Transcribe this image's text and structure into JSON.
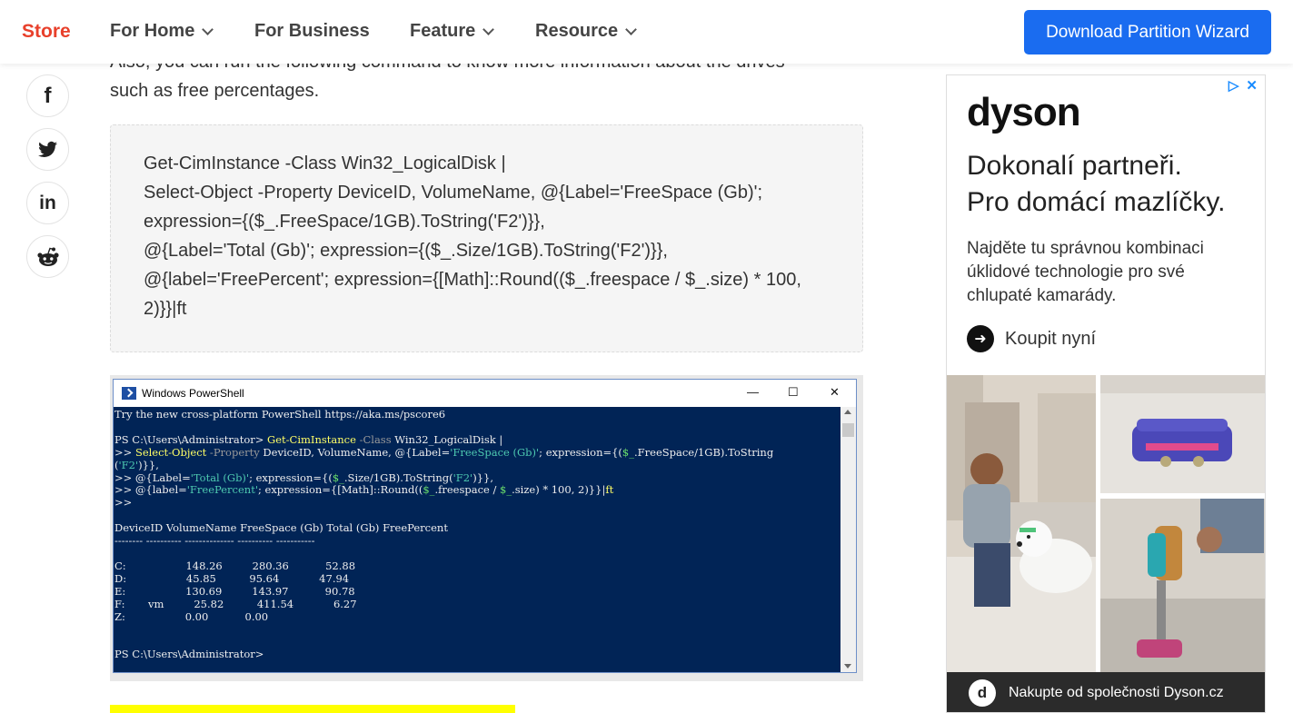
{
  "header": {
    "logo": "Store",
    "nav": [
      {
        "label": "For Home",
        "dropdown": true
      },
      {
        "label": "For Business",
        "dropdown": false
      },
      {
        "label": "Feature",
        "dropdown": true
      },
      {
        "label": "Resource",
        "dropdown": true
      }
    ],
    "download_button": "Download Partition Wizard"
  },
  "share": {
    "icons": [
      "facebook-icon",
      "twitter-icon",
      "linkedin-icon",
      "reddit-icon"
    ],
    "labels": {
      "facebook": "f",
      "linkedin": "in"
    }
  },
  "article": {
    "intro_line1": "Also, you can run the following command to know more information about the drives",
    "intro_line2": "such as free percentages.",
    "code_lines": [
      "Get-CimInstance -Class Win32_LogicalDisk |",
      "Select-Object -Property DeviceID, VolumeName, @{Label='FreeSpace (Gb)';",
      "expression={($_.FreeSpace/1GB).ToString('F2')}},",
      "@{Label='Total (Gb)'; expression={($_.Size/1GB).ToString('F2')}},",
      "@{label='FreePercent'; expression={[Math]::Round(($_.freespace / $_.size) * 100,",
      "2)}}|ft"
    ]
  },
  "powershell": {
    "title": "Windows PowerShell",
    "controls": {
      "minimize": "—",
      "maximize": "☐",
      "close": "✕"
    },
    "intro": "Try the new cross-platform PowerShell https://aka.ms/pscore6",
    "prompt": "PS C:\\Users\\Administrator>",
    "cmd1_a": " Get-CimInstance",
    "cmd1_b": " -Class",
    "cmd1_c": " Win32_LogicalDisk |",
    "cmd2_a": ">> ",
    "cmd2_b": "Select-Object",
    "cmd2_c": " -Property",
    "cmd2_d": " DeviceID, VolumeName, @{Label=",
    "cmd2_e": "'FreeSpace (Gb)'",
    "cmd2_f": "; expression={(",
    "cmd2_g": "$_",
    "cmd2_h": ".FreeSpace/1GB).ToString",
    "cmd3_a": "(",
    "cmd3_b": "'F2'",
    "cmd3_c": ")}},",
    "cmd4_a": ">> @{Label=",
    "cmd4_b": "'Total (Gb)'",
    "cmd4_c": "; expression={(",
    "cmd4_d": "$_",
    "cmd4_e": ".Size/1GB).ToString(",
    "cmd4_f": "'F2'",
    "cmd4_g": ")}},",
    "cmd5_a": ">> @{label=",
    "cmd5_b": "'FreePercent'",
    "cmd5_c": "; expression={[Math]::Round((",
    "cmd5_d": "$_",
    "cmd5_e": ".freespace / ",
    "cmd5_f": "$_",
    "cmd5_g": ".size) * 100, 2)}}|",
    "cmd5_h": "ft",
    "cmd6": ">>",
    "table_header": "DeviceID VolumeName FreeSpace (Gb) Total (Gb) FreePercent",
    "table_rule": "-------- ---------- -------------- ---------- -----------",
    "rows": [
      {
        "device": "C:",
        "volume": "",
        "free": "148.26",
        "total": "280.36",
        "percent": "52.88"
      },
      {
        "device": "D:",
        "volume": "",
        "free": "45.85",
        "total": "95.64",
        "percent": "47.94"
      },
      {
        "device": "E:",
        "volume": "",
        "free": "130.69",
        "total": "143.97",
        "percent": "90.78"
      },
      {
        "device": "F:",
        "volume": "vm",
        "free": "25.82",
        "total": "411.54",
        "percent": "6.27"
      },
      {
        "device": "Z:",
        "volume": "",
        "free": "0.00",
        "total": "0.00",
        "percent": ""
      }
    ],
    "final_prompt": "PS C:\\Users\\Administrator>"
  },
  "ad": {
    "brand": "dyson",
    "headline_line1": "Dokonalí partneři.",
    "headline_line2": "Pro domácí mazlíčky.",
    "body_line1": "Najděte tu správnou kombinaci",
    "body_line2": "úklidové technologie pro své",
    "body_line3": "chlupaté kamarády.",
    "cta": "Koupit nyní",
    "footer": "Nakupte od společnosti Dyson.cz",
    "footer_logo": "d",
    "ad_choices": "▷",
    "ad_close": "✕"
  },
  "colors": {
    "brand_red": "#e8402b",
    "cta_blue": "#1a6cf0",
    "console_bg": "#012456",
    "highlight": "#ffff00"
  }
}
